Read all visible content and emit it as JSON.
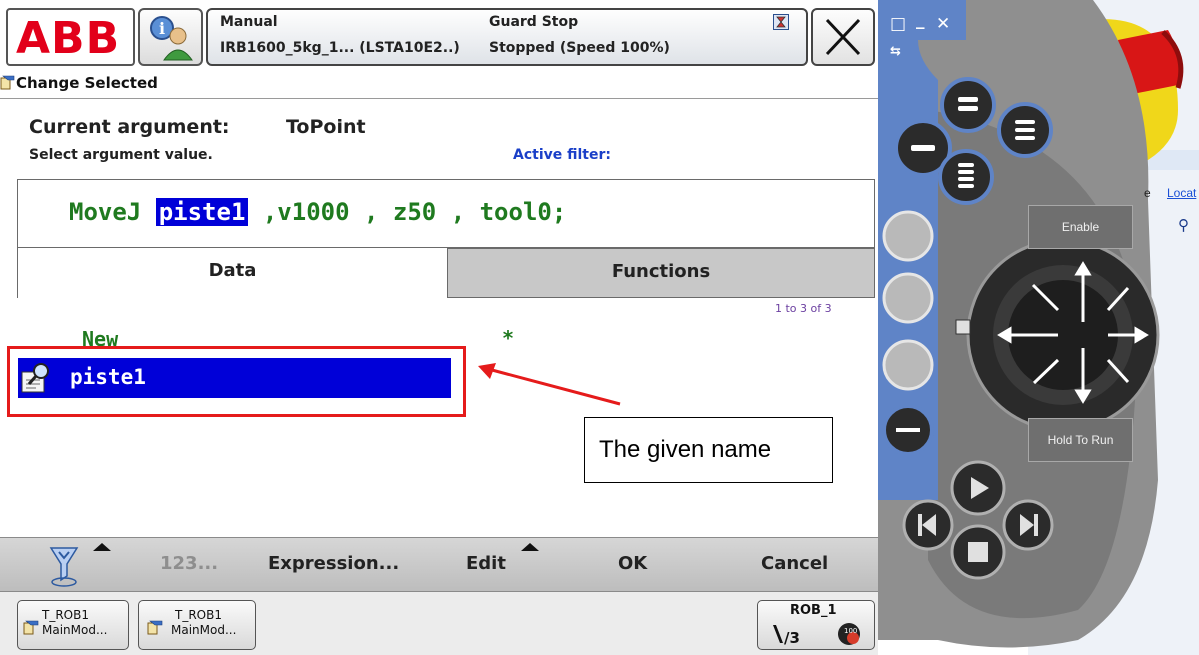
{
  "header": {
    "logo": "ABB",
    "mode": "Manual",
    "robot": "IRB1600_5kg_1... (LSTA10E2..)",
    "guard": "Guard Stop",
    "state": "Stopped (Speed 100%)"
  },
  "window": {
    "title": "Change Selected"
  },
  "argument": {
    "label": "Current argument:",
    "value": "ToPoint",
    "hint": "Select argument value.",
    "filter_label": "Active filter:"
  },
  "instruction": {
    "command": "MoveJ",
    "selected": "piste1",
    "rest": ",v1000 , z50 , tool0;"
  },
  "tabs": {
    "data": "Data",
    "functions": "Functions"
  },
  "list": {
    "range": "1 to 3 of 3",
    "new_label": "New",
    "new_value": "*",
    "selected_item": "piste1"
  },
  "annotation": {
    "callout": "The given name"
  },
  "commands": {
    "num": "123...",
    "expression": "Expression...",
    "edit": "Edit",
    "ok": "OK",
    "cancel": "Cancel"
  },
  "taskbar": {
    "task1": {
      "line1": "T_ROB1",
      "line2": "MainMod..."
    },
    "task2": {
      "line1": "T_ROB1",
      "line2": "MainMod..."
    },
    "rob": "ROB_1"
  },
  "device": {
    "enable": "Enable",
    "hold_to_run": "Hold To Run",
    "side_text_1": "e",
    "side_text_2": "Locat"
  },
  "colors": {
    "abb_red": "#e2001a",
    "selection_blue": "#0000d8",
    "rapid_green": "#1f7a1f",
    "annotation_red": "#e51b1b",
    "device_blue": "#5f84c7"
  }
}
